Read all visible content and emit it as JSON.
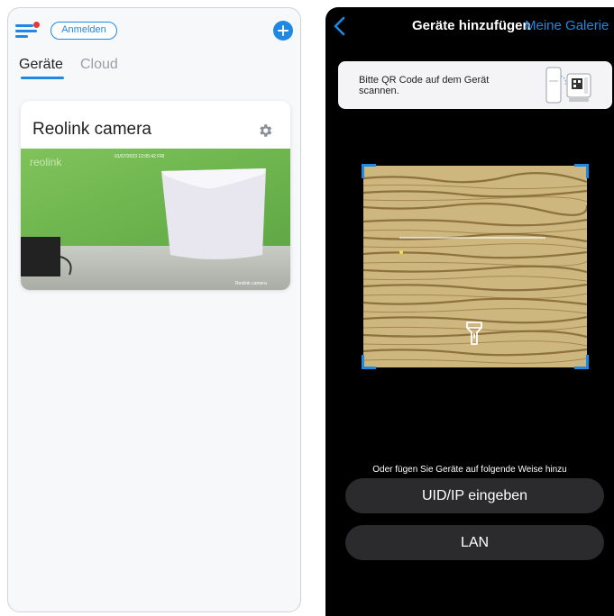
{
  "left": {
    "login_label": "Anmelden",
    "tabs": [
      {
        "label": "Geräte",
        "active": true
      },
      {
        "label": "Cloud",
        "active": false
      }
    ],
    "camera": {
      "name": "Reolink camera",
      "thumbnail_brand": "reolink",
      "thumbnail_timestamp": "01/07/2023 12:05:42 FRI",
      "thumbnail_label": "Reolink camera"
    }
  },
  "right": {
    "title": "Geräte hinzufügen",
    "gallery_link": "Meine Galerie",
    "qr_hint": "Bitte QR Code auf dem Gerät scannen.",
    "alt_methods_text": "Oder fügen Sie Geräte auf folgende Weise hinzu",
    "buttons": {
      "uid_ip": "UID/IP eingeben",
      "lan": "LAN"
    }
  },
  "colors": {
    "accent": "#1e88e5",
    "notification_dot": "#e53935",
    "dark_bg": "#000000",
    "button_bg": "#2b2b2d"
  },
  "icons": [
    "hamburger-menu-icon",
    "plus-circle-icon",
    "gear-icon",
    "chevron-left-icon",
    "flashlight-icon",
    "phone-qr-illustration"
  ]
}
